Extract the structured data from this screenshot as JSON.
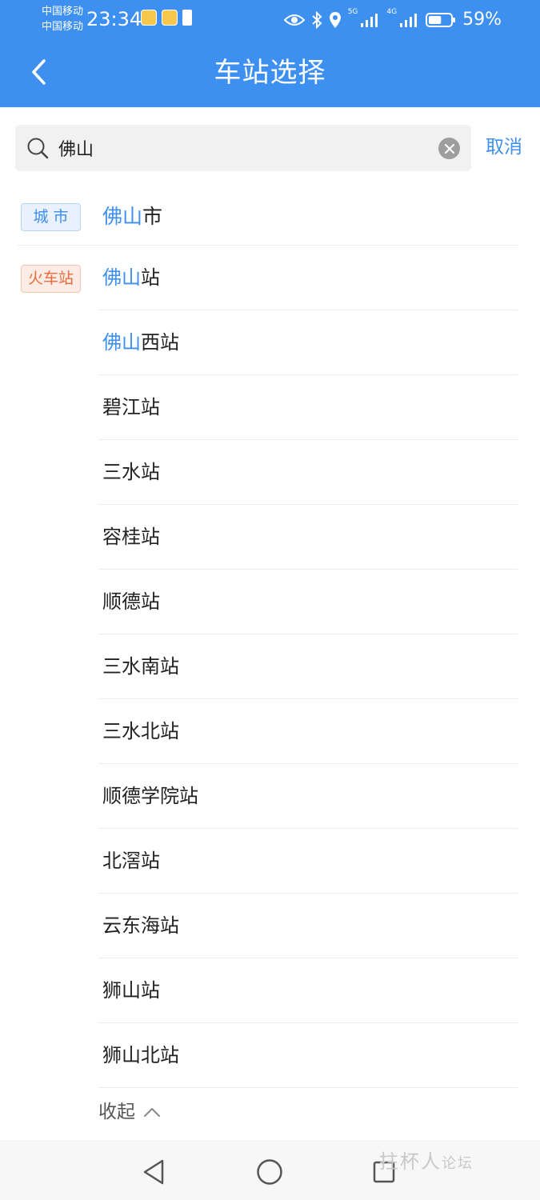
{
  "status_bar": {
    "carrier_1": "中国移动",
    "carrier_2": "中国移动",
    "time": "23:34",
    "network_1": "5G",
    "network_2": "4G",
    "battery_percent": "59%",
    "battery_level": 0.59,
    "icons": [
      "eye-icon",
      "bluetooth-icon",
      "location-icon",
      "signal-icon",
      "battery-icon"
    ]
  },
  "header": {
    "title": "车站选择",
    "back_icon": "chevron-left-icon"
  },
  "search": {
    "value": "佛山",
    "cancel_label": "取消",
    "clear_icon": "clear-icon",
    "search_icon": "search-icon"
  },
  "results": {
    "city_tag": "城市",
    "city": {
      "highlight": "佛山",
      "rest": "市"
    },
    "station_tag": "火车站",
    "stations": [
      {
        "highlight": "佛山",
        "rest": "站"
      },
      {
        "highlight": "佛山",
        "rest": "西站"
      },
      {
        "highlight": "",
        "rest": "碧江站"
      },
      {
        "highlight": "",
        "rest": "三水站"
      },
      {
        "highlight": "",
        "rest": "容桂站"
      },
      {
        "highlight": "",
        "rest": "顺德站"
      },
      {
        "highlight": "",
        "rest": "三水南站"
      },
      {
        "highlight": "",
        "rest": "三水北站"
      },
      {
        "highlight": "",
        "rest": "顺德学院站"
      },
      {
        "highlight": "",
        "rest": "北滘站"
      },
      {
        "highlight": "",
        "rest": "云东海站"
      },
      {
        "highlight": "",
        "rest": "狮山站"
      },
      {
        "highlight": "",
        "rest": "狮山北站"
      }
    ],
    "collapse_label": "收起"
  },
  "nav_bar": {
    "buttons": [
      "back-triangle-icon",
      "home-circle-icon",
      "recents-square-icon"
    ]
  },
  "watermark": {
    "text": "拄杯人",
    "suffix": "论坛"
  },
  "colors": {
    "primary": "#3d8ff0",
    "train_tag": "#ec6b3e"
  }
}
